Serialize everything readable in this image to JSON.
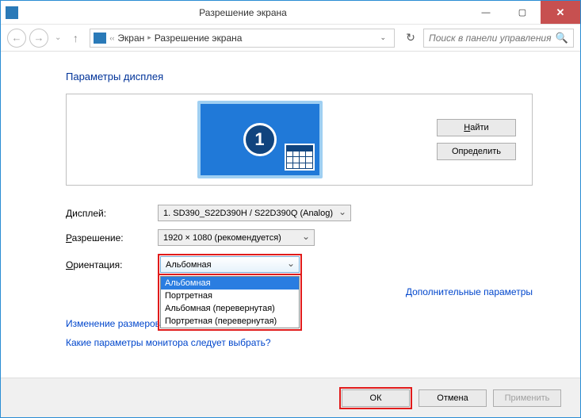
{
  "titlebar": {
    "title": "Разрешение экрана"
  },
  "navbar": {
    "breadcrumb": {
      "item1": "Экран",
      "item2": "Разрешение экрана"
    },
    "search_placeholder": "Поиск в панели управления"
  },
  "heading": "Параметры дисплея",
  "monitor_number": "1",
  "side_buttons": {
    "find": "Найти",
    "detect": "Определить"
  },
  "form": {
    "display_label": "Дисплей:",
    "display_value": "1. SD390_S22D390H / S22D390Q (Analog)",
    "resolution_label": "Разрешение:",
    "resolution_value": "1920 × 1080 (рекомендуется)",
    "orientation_label": "Ориентация:",
    "orientation_value": "Альбомная",
    "orientation_options": [
      "Альбомная",
      "Портретная",
      "Альбомная (перевернутая)",
      "Портретная (перевернутая)"
    ]
  },
  "links": {
    "advanced": "Дополнительные параметры",
    "text_size": "Изменение размеров те",
    "which_monitor": "Какие параметры монитора следует выбрать?"
  },
  "footer": {
    "ok": "ОК",
    "cancel": "Отмена",
    "apply": "Применить"
  }
}
